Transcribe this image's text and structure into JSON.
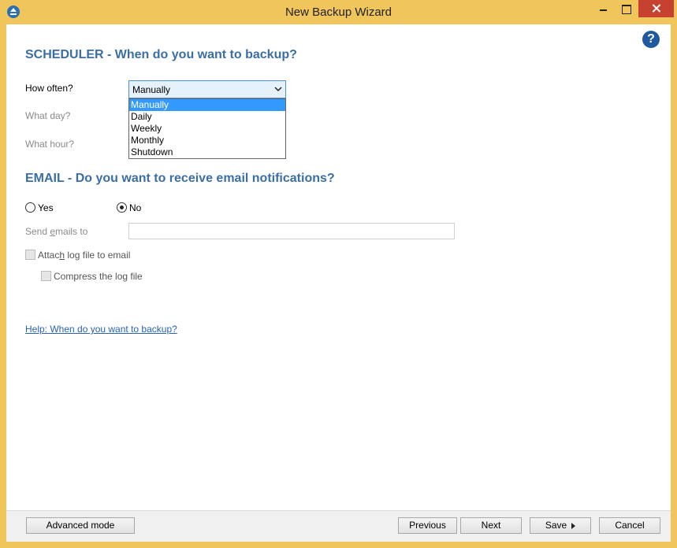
{
  "window": {
    "title": "New Backup Wizard",
    "app_icon": "backup-app-icon",
    "controls": [
      "minimize-icon",
      "maximize-icon",
      "close-icon"
    ]
  },
  "help_icon": {
    "glyph": "?",
    "icon": "help-circle-icon"
  },
  "scheduler": {
    "title": "SCHEDULER - When do you want to backup?",
    "how_often_label": "How often?",
    "how_often_value": "Manually",
    "what_day_label": "What day?",
    "what_hour_label": "What hour?",
    "options": [
      "Manually",
      "Daily",
      "Weekly",
      "Monthly",
      "Shutdown"
    ],
    "selected_option": "Manually"
  },
  "email": {
    "title": "EMAIL - Do you want to receive email notifications?",
    "yes_label": "Yes",
    "no_label": "No",
    "selected": "No",
    "send_emails_prefix": "Send ",
    "send_emails_u": "e",
    "send_emails_suffix": "mails to",
    "send_emails_value": "",
    "attach_prefix": "Attac",
    "attach_u": "h",
    "attach_suffix": " log file to email",
    "attach_checked": false,
    "compress_label": "Compress the log file",
    "compress_checked": false
  },
  "help_link": "Help: When do you want to backup?",
  "footer": {
    "advanced_mode": "Advanced mode",
    "previous": "Previous",
    "next": "Next",
    "save": "Save",
    "cancel": "Cancel"
  },
  "colors": {
    "frame": "#f0c55b",
    "accent_heading": "#3a6ea5",
    "selection": "#3399ff",
    "close_button": "#c74131",
    "link": "#2a63b3"
  }
}
